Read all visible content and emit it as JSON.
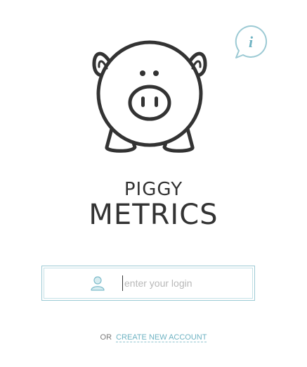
{
  "colors": {
    "accent": "#6fb3c3",
    "input_border": "#9ccad4",
    "logo_stroke": "#333333",
    "text_dark": "#333333",
    "placeholder": "#b8b8b8"
  },
  "info_button": {
    "icon": "info-icon",
    "glyph": "i"
  },
  "logo": {
    "icon": "piggy-bank-logo"
  },
  "brand": {
    "line1": "PIGGY",
    "line2": "METRICS"
  },
  "login": {
    "icon": "user-icon",
    "value": "",
    "placeholder": "enter your login"
  },
  "footer": {
    "prefix": "OR",
    "create_account_label": "CREATE NEW ACCOUNT"
  }
}
